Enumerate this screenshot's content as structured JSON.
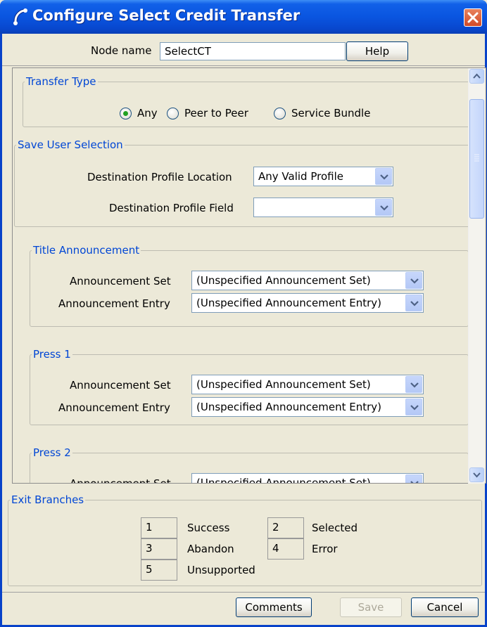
{
  "window": {
    "title": "Configure Select Credit Transfer"
  },
  "node": {
    "label": "Node name",
    "value": "SelectCT",
    "help": "Help"
  },
  "transfer_type": {
    "legend": "Transfer Type",
    "options": [
      "Any",
      "Peer to Peer",
      "Service Bundle"
    ],
    "selected": "Any"
  },
  "save_user_selection": {
    "legend": "Save User Selection",
    "location_label": "Destination Profile Location",
    "location_value": "Any Valid Profile",
    "field_label": "Destination Profile Field",
    "field_value": ""
  },
  "announcements": [
    {
      "legend": "Title Announcement",
      "set_label": "Announcement Set",
      "set_value": "(Unspecified Announcement Set)",
      "entry_label": "Announcement Entry",
      "entry_value": "(Unspecified Announcement Entry)"
    },
    {
      "legend": "Press 1",
      "set_label": "Announcement Set",
      "set_value": "(Unspecified Announcement Set)",
      "entry_label": "Announcement Entry",
      "entry_value": "(Unspecified Announcement Entry)"
    },
    {
      "legend": "Press 2",
      "set_label": "Announcement Set",
      "set_value": "(Unspecified Announcement Set)"
    }
  ],
  "exit_branches": {
    "legend": "Exit Branches",
    "items": [
      {
        "num": "1",
        "label": "Success"
      },
      {
        "num": "2",
        "label": "Selected"
      },
      {
        "num": "3",
        "label": "Abandon"
      },
      {
        "num": "4",
        "label": "Error"
      },
      {
        "num": "5",
        "label": "Unsupported"
      }
    ]
  },
  "footer": {
    "comments": "Comments",
    "save": "Save",
    "cancel": "Cancel"
  },
  "colors": {
    "title_bar": "#0a55e0",
    "legend": "#0046d5",
    "window_bg": "#ece9d8",
    "radio_dot": "#21a121"
  }
}
